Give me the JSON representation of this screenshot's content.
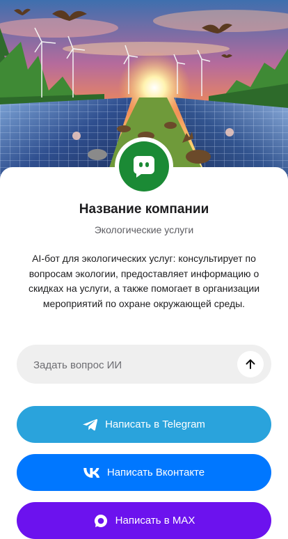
{
  "company": {
    "name": "Название компании",
    "subtitle": "Экологические услуги",
    "description": "AI-бот для экологических услуг: консультирует по вопросам экологии, предоставляет информацию о скидках на услуги, а также помогает в организации мероприятий по охране окружающей среды."
  },
  "ask": {
    "placeholder": "Задать вопрос ИИ",
    "value": ""
  },
  "buttons": {
    "telegram": "Написать в Telegram",
    "vk": "Написать Вконтакте",
    "max": "Написать в MAX"
  },
  "colors": {
    "avatar": "#1b8a35",
    "telegram": "#2aa3dc",
    "vk": "#0077ff",
    "max": "#6c12ee",
    "input_bg": "#efefef"
  },
  "icons": {
    "avatar": "chat-bot-icon",
    "send": "arrow-up-icon",
    "telegram": "telegram-icon",
    "vk": "vk-icon",
    "max": "max-icon"
  }
}
